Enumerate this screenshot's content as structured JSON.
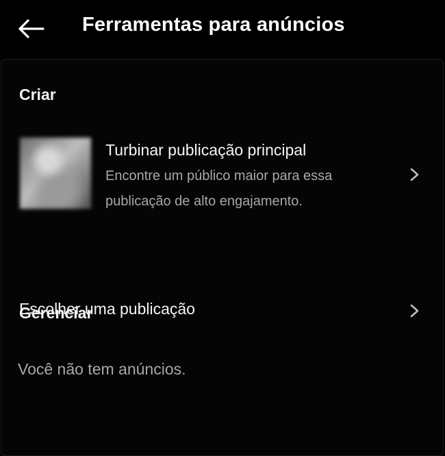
{
  "header": {
    "title": "Ferramentas para anúncios",
    "back_icon": "arrow-left-icon"
  },
  "create_section": {
    "heading": "Criar",
    "boost_item": {
      "title": "Turbinar publicação principal",
      "description": "Encontre um público maior para essa publicação de alto engajamento.",
      "thumbnail": "post-thumbnail",
      "chevron_icon": "chevron-right-icon"
    },
    "choose_item": {
      "label": "Escolher uma publicação",
      "chevron_icon": "chevron-right-icon"
    }
  },
  "manage_section": {
    "heading": "Gerenciar",
    "empty_message": "Você não tem anúncios."
  }
}
